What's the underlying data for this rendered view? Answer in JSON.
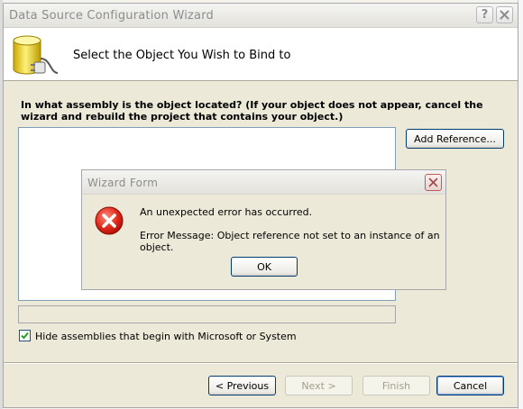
{
  "window": {
    "title": "Data Source Configuration Wizard",
    "help_glyph": "?",
    "close_glyph": "✕"
  },
  "header": {
    "title": "Select the Object You Wish to Bind to",
    "icon": "database-connect-icon"
  },
  "body": {
    "question": "In what assembly is the object located? (If your object does not appear, cancel the wizard and rebuild the project that contains your object.)",
    "add_reference_label": "Add Reference...",
    "hide_assemblies": {
      "label": "Hide assemblies that begin with Microsoft or System",
      "checked": true
    }
  },
  "footer": {
    "previous_label": "< Previous",
    "next_label": "Next >",
    "finish_label": "Finish",
    "cancel_label": "Cancel"
  },
  "modal": {
    "title": "Wizard Form",
    "line1": "An unexpected error has occurred.",
    "line2": "Error Message: Object reference not set to an instance of an object.",
    "ok_label": "OK",
    "icon": "error-icon"
  },
  "colors": {
    "window_bg": "#ece9d8",
    "button_border": "#003c74",
    "error_red": "#d42020"
  }
}
